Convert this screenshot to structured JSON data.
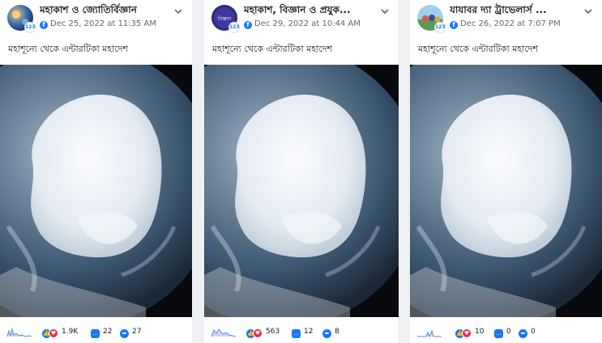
{
  "posts": [
    {
      "page_name": "মহাকাশ ও জ্যোতির্বিজ্ঞান",
      "date": "Dec 25, 2022 at 11:35 AM",
      "caption": "মহাশূন্যে থেকে এন্টারটিকা মহাদেশ",
      "reactions": "1.9K",
      "comments": "22",
      "shares": "27",
      "avatar_badge": "123"
    },
    {
      "page_name": "মহাকাশ, বিজ্ঞান ও প্রযুক...",
      "date": "Dec 29, 2022 at 10:44 AM",
      "caption": "মহাশূন্যে থেকে এন্টারটিকা মহাদেশ",
      "reactions": "563",
      "comments": "12",
      "shares": "8",
      "avatar_text": "বিজ্ঞান",
      "avatar_badge": "123"
    },
    {
      "page_name": "যাযাবর দ্যা ট্রাভেলার্স ...",
      "date": "Dec 26, 2022 at 7:07 PM",
      "caption": "মহাশূন্যে থেকে এন্টারটিকা মহাদেশ",
      "reactions": "10",
      "comments": "0",
      "shares": "0",
      "avatar_badge": "123"
    }
  ],
  "icons": {
    "chevron": "chevron-down-icon",
    "facebook": "facebook-icon",
    "reactions": "reactions-icon",
    "comment": "comment-icon",
    "share": "share-icon",
    "sparkline": "sparkline-icon"
  },
  "colors": {
    "accent": "#1877f2",
    "text": "#1c1e21",
    "muted": "#606770",
    "love": "#f02849"
  }
}
